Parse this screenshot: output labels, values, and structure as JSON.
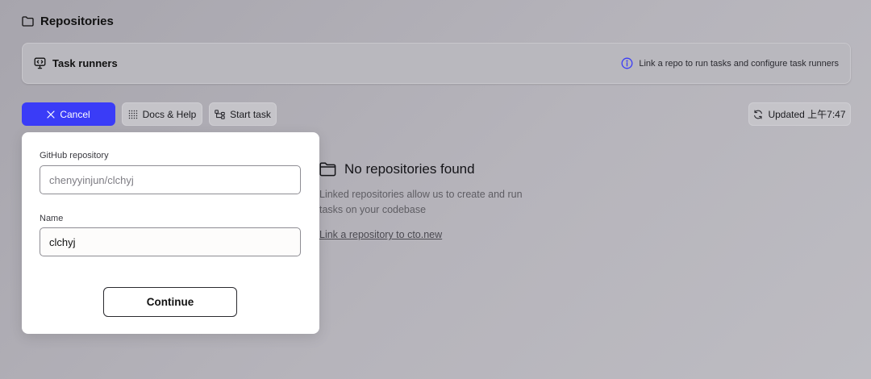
{
  "header": {
    "title": "Repositories",
    "icon": "folder-icon"
  },
  "task_runners": {
    "title": "Task runners",
    "icon": "monitor-code-icon",
    "info_icon": "info-icon",
    "info_text": "Link a repo to run tasks and configure task runners"
  },
  "toolbar": {
    "cancel_label": "Cancel",
    "docs_label": "Docs & Help",
    "start_task_label": "Start task",
    "updated_label": "Updated 上午7:47"
  },
  "form": {
    "repo_label": "GitHub repository",
    "repo_placeholder": "chenyyinjun/clchyj",
    "repo_value": "",
    "name_label": "Name",
    "name_value": "clchyj",
    "continue_label": "Continue"
  },
  "empty_state": {
    "title": "No repositories found",
    "description": "Linked repositories allow us to create and run tasks on your codebase",
    "link_text": "Link a repository to cto.new"
  },
  "colors": {
    "accent": "#3a3cf7",
    "background": "#b2b0b7",
    "panel": "#b9b8be",
    "card": "#ffffff"
  }
}
